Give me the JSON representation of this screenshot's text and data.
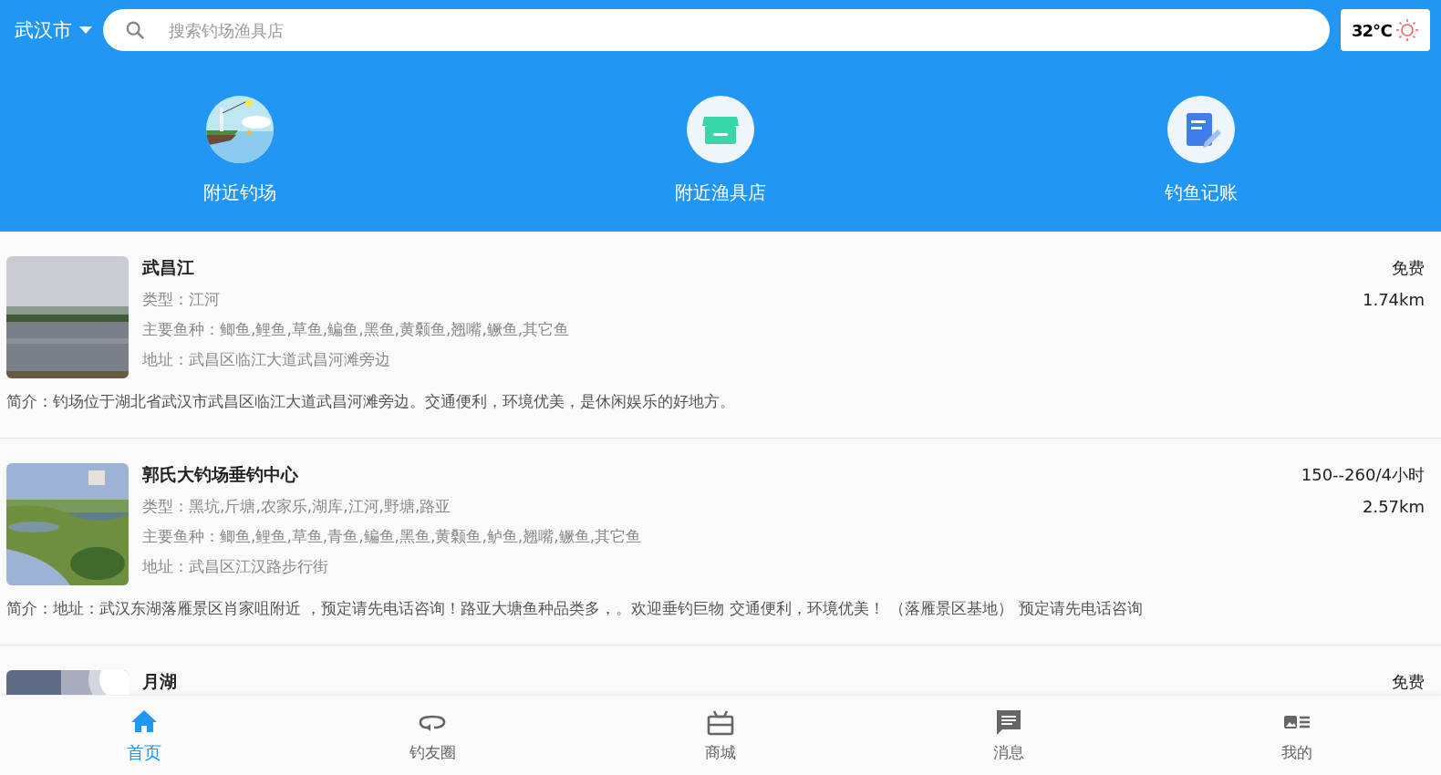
{
  "header": {
    "city": "武汉市",
    "search": {
      "placeholder": "搜索钓场渔具店"
    },
    "weather": {
      "temperature": "32℃",
      "kind": "sunny"
    }
  },
  "shortcuts": [
    {
      "label": "附近钓场",
      "kind": "fishing"
    },
    {
      "label": "附近渔具店",
      "kind": "store"
    },
    {
      "label": "钓鱼记账",
      "kind": "notes"
    }
  ],
  "spots": [
    {
      "name": "武昌江",
      "type": "类型：江河",
      "fish": "主要鱼种：鲫鱼,鲤鱼,草鱼,鳊鱼,黑鱼,黄颡鱼,翘嘴,鳜鱼,其它鱼",
      "address": "地址：武昌区临江大道武昌河滩旁边",
      "intro": "简介：钓场位于湖北省武汉市武昌区临江大道武昌河滩旁边。交通便利，环境优美，是休闲娱乐的好地方。",
      "price": "免费",
      "distance": "1.74km",
      "kind": "river"
    },
    {
      "name": "郭氏大钓场垂钓中心",
      "type": "类型：黑坑,斤塘,农家乐,湖库,江河,野塘,路亚",
      "fish": "主要鱼种：鲫鱼,鲤鱼,草鱼,青鱼,鳊鱼,黑鱼,黄颡鱼,鲈鱼,翘嘴,鳜鱼,其它鱼",
      "address": "地址：武昌区江汉路步行街",
      "intro": "简介：地址：武汉东湖落雁景区肖家咀附近 ，预定请先电话咨询！路亚大塘鱼种品类多，。欢迎垂钓巨物 交通便利，环境优美！ （落雁景区基地） 预定请先电话咨询",
      "price": "150--260/4小时",
      "distance": "2.57km",
      "kind": "pond"
    },
    {
      "name": "月湖",
      "price": "免费",
      "kind": "sun"
    }
  ],
  "tabs": [
    {
      "label": "首页",
      "kind": "home",
      "selected": true
    },
    {
      "label": "钓友圈",
      "kind": "loop",
      "selected": false
    },
    {
      "label": "商城",
      "kind": "gift",
      "selected": false
    },
    {
      "label": "消息",
      "kind": "chat",
      "selected": false
    },
    {
      "label": "我的",
      "kind": "profile",
      "selected": false
    }
  ]
}
